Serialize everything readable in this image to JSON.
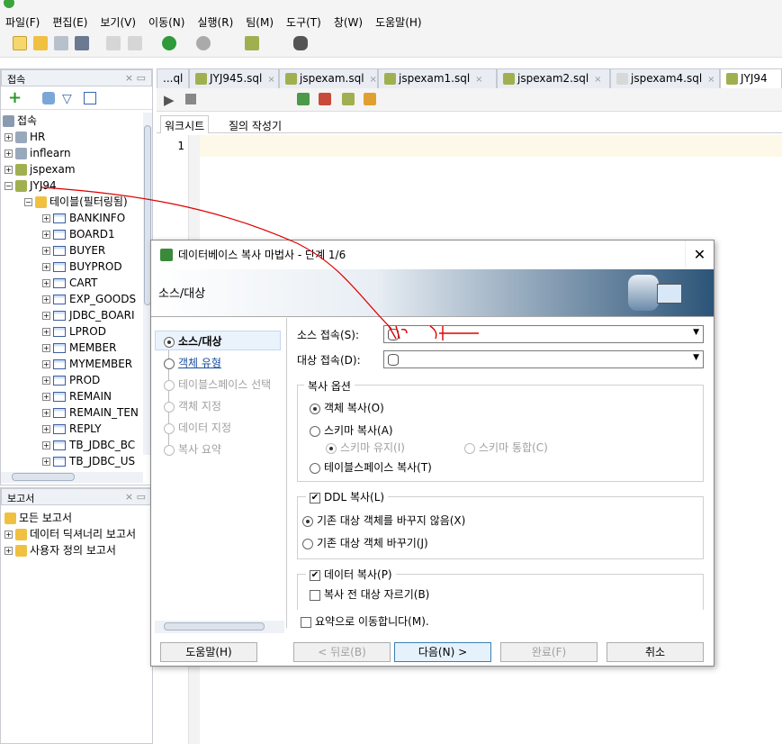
{
  "menu": [
    "파일(F)",
    "편집(E)",
    "보기(V)",
    "이동(N)",
    "실행(R)",
    "팀(M)",
    "도구(T)",
    "창(W)",
    "도움말(H)"
  ],
  "connections_panel": {
    "title": "접속",
    "root": "접속",
    "items": [
      "HR",
      "inflearn",
      "jspexam",
      "JYJ94"
    ],
    "tables_node": "테이블(필터링됨)",
    "tables": [
      "BANKINFO",
      "BOARD1",
      "BUYER",
      "BUYPROD",
      "CART",
      "EXP_GOODS",
      "JDBC_BOARI",
      "LPROD",
      "MEMBER",
      "MYMEMBER",
      "PROD",
      "REMAIN",
      "REMAIN_TEN",
      "REPLY",
      "TB_JDBC_BC",
      "TB_JDBC_US"
    ]
  },
  "reports_panel": {
    "title": "보고서",
    "items": [
      "모든 보고서",
      "데이터 딕셔너리 보고서",
      "사용자 정의 보고서"
    ]
  },
  "tabs": [
    "...ql",
    "JYJ945.sql",
    "jspexam.sql",
    "jspexam1.sql",
    "jspexam2.sql",
    "jspexam4.sql",
    "JYJ94"
  ],
  "worksheet": {
    "tab1": "워크시트",
    "tab2": "질의 작성기",
    "line_no": "1"
  },
  "dialog": {
    "title": "데이터베이스 복사 마법사 - 단계 1/6",
    "banner": "소스/대상",
    "steps": [
      "소스/대상",
      "객체 유형",
      "테이블스페이스 선택",
      "객체 지정",
      "데이터 지정",
      "복사 요약"
    ],
    "source_label": "소스 접속(S):",
    "target_label": "대상 접속(D):",
    "copy_options": {
      "title": "복사 옵션",
      "object_copy": "객체 복사(O)",
      "schema_copy": "스키마 복사(A)",
      "keep_schema": "스키마 유지(I)",
      "merge_schema": "스키마 통합(C)",
      "tablespace_copy": "테이블스페이스 복사(T)"
    },
    "ddl": {
      "title": "DDL 복사(L)",
      "no_replace": "기존 대상 객체를 바꾸지 않음(X)",
      "replace": "기존 대상 객체 바꾸기(J)"
    },
    "data": {
      "title": "데이터 복사(P)",
      "truncate": "복사 전 대상 자르기(B)"
    },
    "summary_check": "요약으로 이동합니다(M).",
    "buttons": {
      "help": "도움말(H)",
      "back": "< 뒤로(B)",
      "next": "다음(N) >",
      "finish": "완료(F)",
      "cancel": "취소"
    }
  }
}
